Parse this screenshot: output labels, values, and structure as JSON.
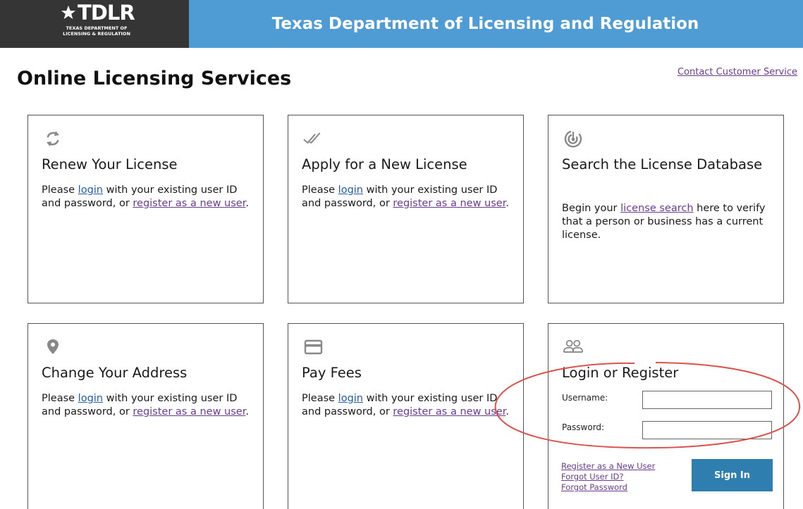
{
  "header": {
    "logo_text": "TDLR",
    "logo_sub_1": "TEXAS DEPARTMENT OF",
    "logo_sub_2": "LICENSING & REGULATION",
    "title": "Texas Department of Licensing and Regulation"
  },
  "page": {
    "title": "Online Licensing Services",
    "contact_link": "Contact Customer Service"
  },
  "cards": [
    {
      "icon": "renew-icon",
      "title": "Renew Your License",
      "body_pre": "Please ",
      "login": "login",
      "body_mid": " with your existing user ID and password, or ",
      "register": "register as a new user",
      "body_post": "."
    },
    {
      "icon": "checkmark-icon",
      "title": "Apply for a New License",
      "body_pre": "Please ",
      "login": "login",
      "body_mid": " with your existing user ID and password, or ",
      "register": "register as a new user",
      "body_post": "."
    },
    {
      "icon": "radar-icon",
      "title": "Search the License Database",
      "body_pre": "Begin your ",
      "link": "license search",
      "body_post": " here to verify that a person or business has a current license."
    },
    {
      "icon": "location-pin-icon",
      "title": "Change Your Address",
      "body_pre": "Please ",
      "login": "login",
      "body_mid": " with your existing user ID and password, or ",
      "register": "register as a new user",
      "body_post": "."
    },
    {
      "icon": "credit-card-icon",
      "title": "Pay Fees",
      "body_pre": "Please ",
      "login": "login",
      "body_mid": " with your existing user ID and password, or ",
      "register": "register as a new user",
      "body_post": "."
    }
  ],
  "login": {
    "icon": "users-icon",
    "title": "Login or Register",
    "username_label": "Username:",
    "username_value": "",
    "password_label": "Password:",
    "password_value": "",
    "register_link": "Register as a New User",
    "forgot_user": "Forgot User ID?",
    "forgot_password": "Forgot Password",
    "sign_in": "Sign In"
  },
  "colors": {
    "header_dark": "#353535",
    "header_blue": "#4f9bd4",
    "link_purple": "#6a3b91",
    "link_blue": "#1f5ea8",
    "button_blue": "#2e7fb0",
    "annotation_red": "#d9534f"
  }
}
